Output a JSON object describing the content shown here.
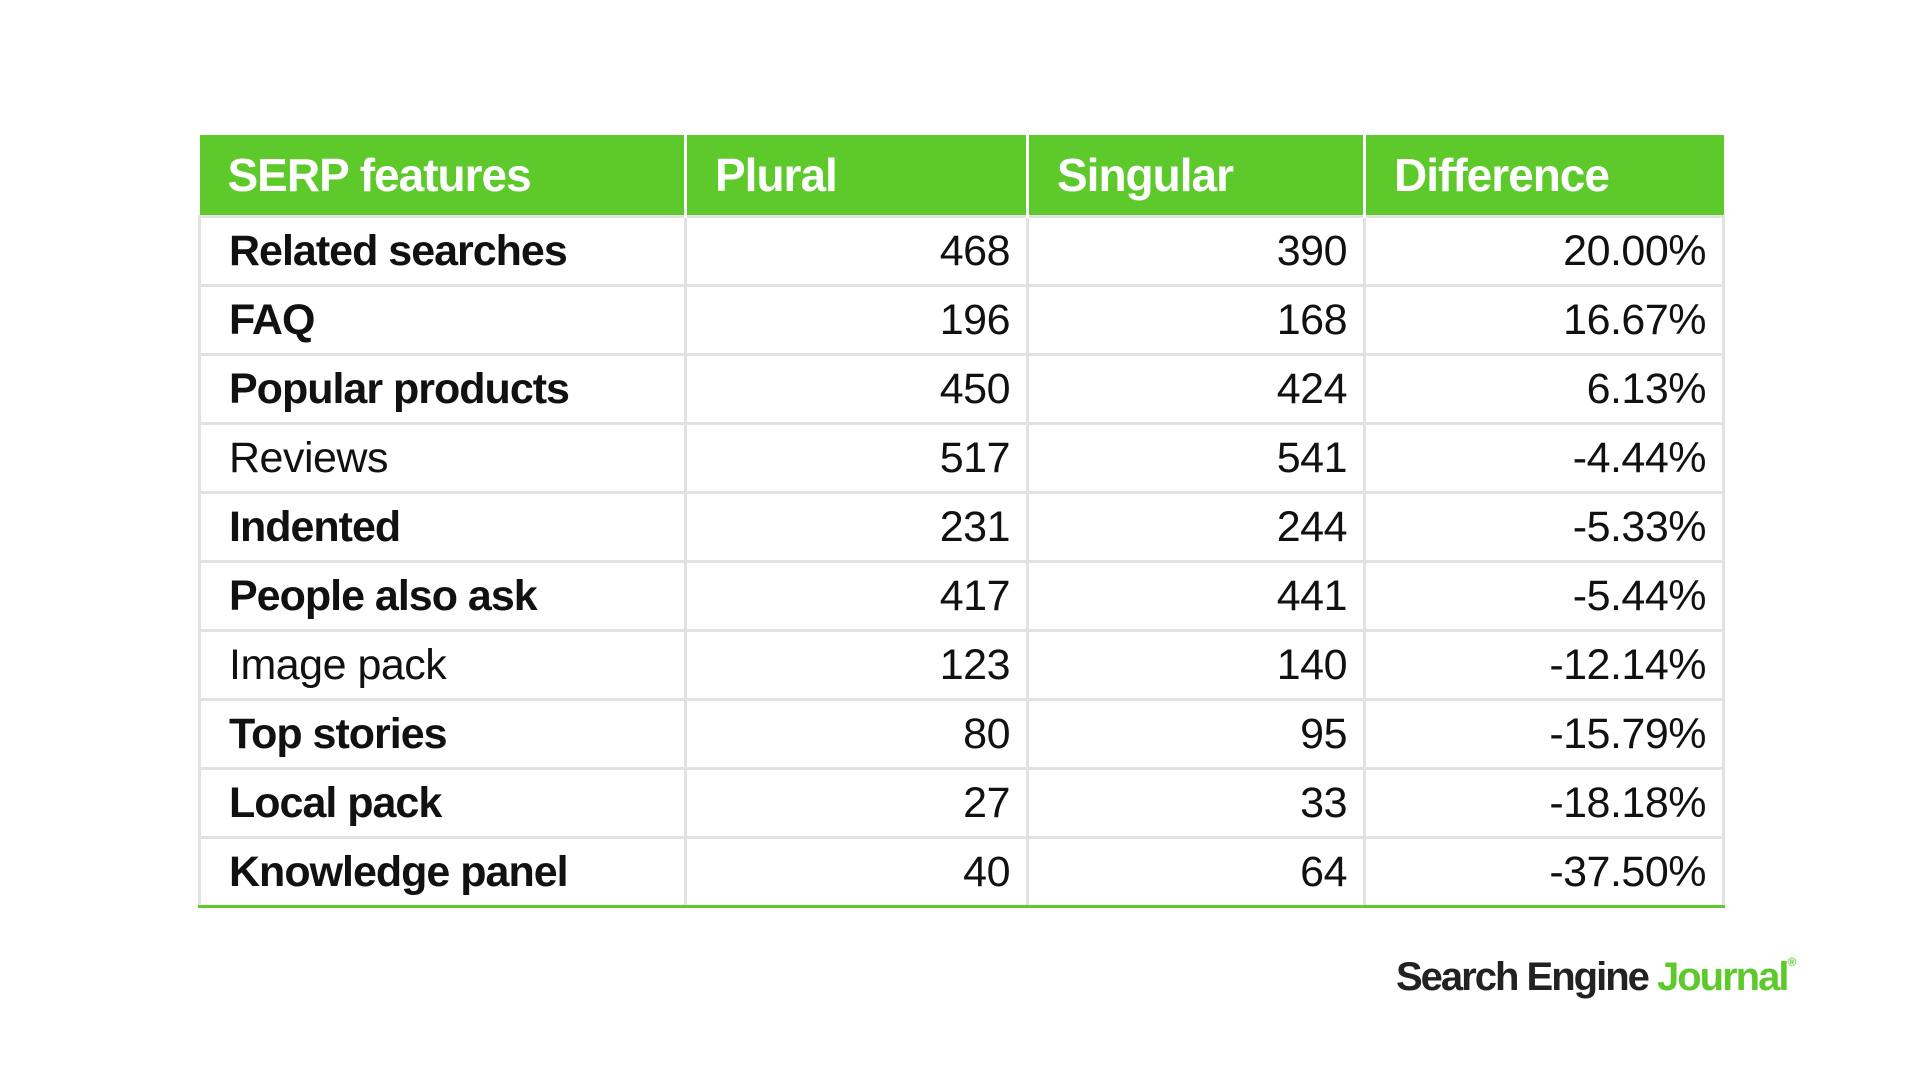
{
  "table": {
    "headers": [
      "SERP features",
      "Plural",
      "Singular",
      "Difference"
    ],
    "rows": [
      {
        "feature": "Related searches",
        "plural": "468",
        "singular": "390",
        "difference": "20.00%",
        "bold": true
      },
      {
        "feature": "FAQ",
        "plural": "196",
        "singular": "168",
        "difference": "16.67%",
        "bold": true
      },
      {
        "feature": "Popular products",
        "plural": "450",
        "singular": "424",
        "difference": "6.13%",
        "bold": true
      },
      {
        "feature": "Reviews",
        "plural": "517",
        "singular": "541",
        "difference": "-4.44%",
        "bold": false
      },
      {
        "feature": "Indented",
        "plural": "231",
        "singular": "244",
        "difference": "-5.33%",
        "bold": true
      },
      {
        "feature": "People also ask",
        "plural": "417",
        "singular": "441",
        "difference": "-5.44%",
        "bold": true
      },
      {
        "feature": "Image pack",
        "plural": "123",
        "singular": "140",
        "difference": "-12.14%",
        "bold": false
      },
      {
        "feature": "Top stories",
        "plural": "80",
        "singular": "95",
        "difference": "-15.79%",
        "bold": true
      },
      {
        "feature": "Local pack",
        "plural": "27",
        "singular": "33",
        "difference": "-18.18%",
        "bold": true
      },
      {
        "feature": "Knowledge panel",
        "plural": "40",
        "singular": "64",
        "difference": "-37.50%",
        "bold": true
      }
    ]
  },
  "logo": {
    "part1": "Search Engine ",
    "part2": "Journal",
    "mark": "®"
  },
  "colors": {
    "accent": "#5dc92b",
    "grid": "#e2e2e2"
  }
}
